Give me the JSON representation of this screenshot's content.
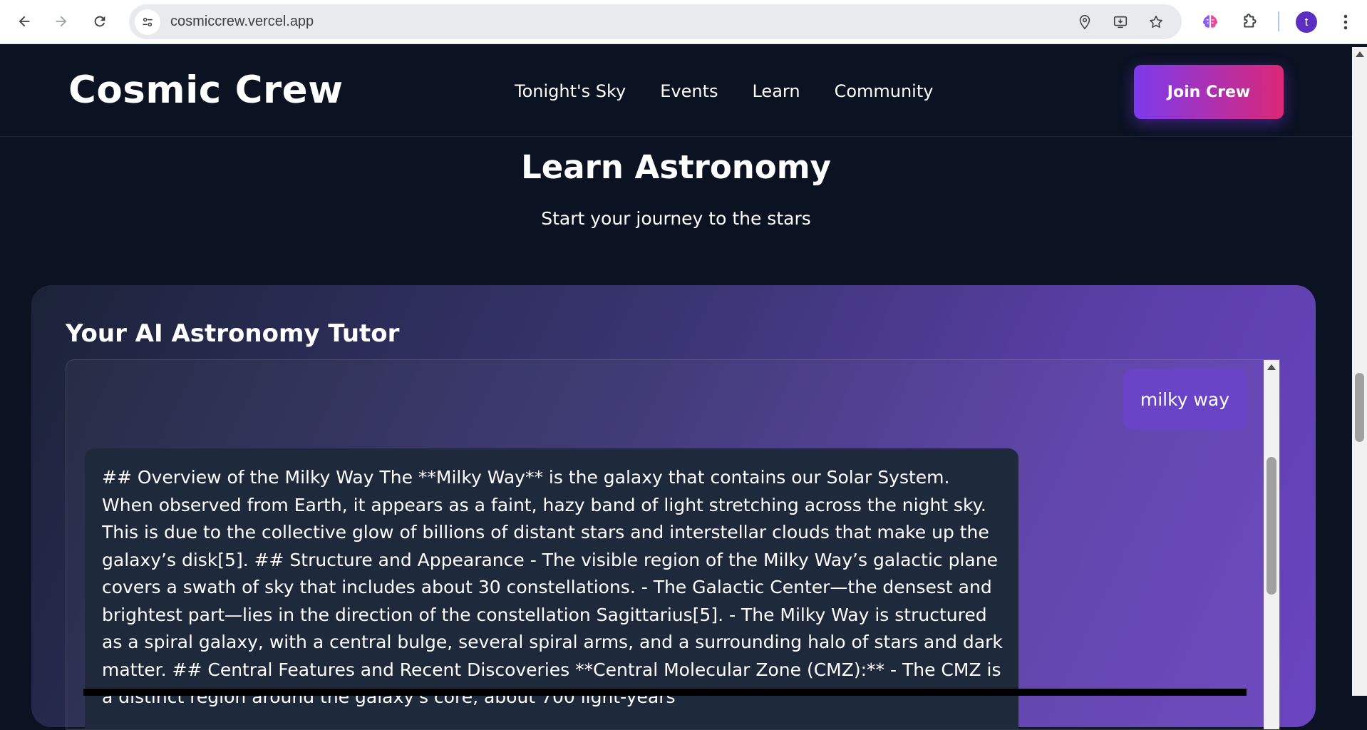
{
  "browser": {
    "url": "cosmiccrew.vercel.app",
    "avatar_letter": "t",
    "icons": [
      "back-icon",
      "forward-icon",
      "reload-icon",
      "site-info-icon",
      "location-icon",
      "install-app-icon",
      "bookmark-star-icon",
      "brain-extension-icon",
      "puzzle-extension-icon",
      "kebab-menu-icon"
    ]
  },
  "header": {
    "brand": "Cosmic Crew",
    "nav": [
      "Tonight's Sky",
      "Events",
      "Learn",
      "Community"
    ],
    "cta": "Join Crew"
  },
  "hero": {
    "title": "Learn Astronomy",
    "subtitle": "Start your journey to the stars"
  },
  "tutor": {
    "title": "Your AI Astronomy Tutor",
    "messages": [
      {
        "role": "user",
        "text": "milky way"
      },
      {
        "role": "assistant",
        "text": "## Overview of the Milky Way The **Milky Way** is the galaxy that contains our Solar System. When observed from Earth, it appears as a faint, hazy band of light stretching across the night sky. This is due to the collective glow of billions of distant stars and interstellar clouds that make up the galaxy’s disk[5]. ## Structure and Appearance - The visible region of the Milky Way’s galactic plane covers a swath of sky that includes about 30 constellations. - The Galactic Center—the densest and brightest part—lies in the direction of the constellation Sagittarius[5]. - The Milky Way is structured as a spiral galaxy, with a central bulge, several spiral arms, and a surrounding halo of stars and dark matter. ## Central Features and Recent Discoveries **Central Molecular Zone (CMZ):** - The CMZ is a distinct region around the galaxy's core, about 700 light-years"
      }
    ]
  },
  "colors": {
    "page_bg": "#0b1222",
    "cta_gradient_start": "#7c3aed",
    "cta_gradient_end": "#db2777",
    "user_bubble": "#6a44c7",
    "ai_bubble": "#1e293b"
  }
}
